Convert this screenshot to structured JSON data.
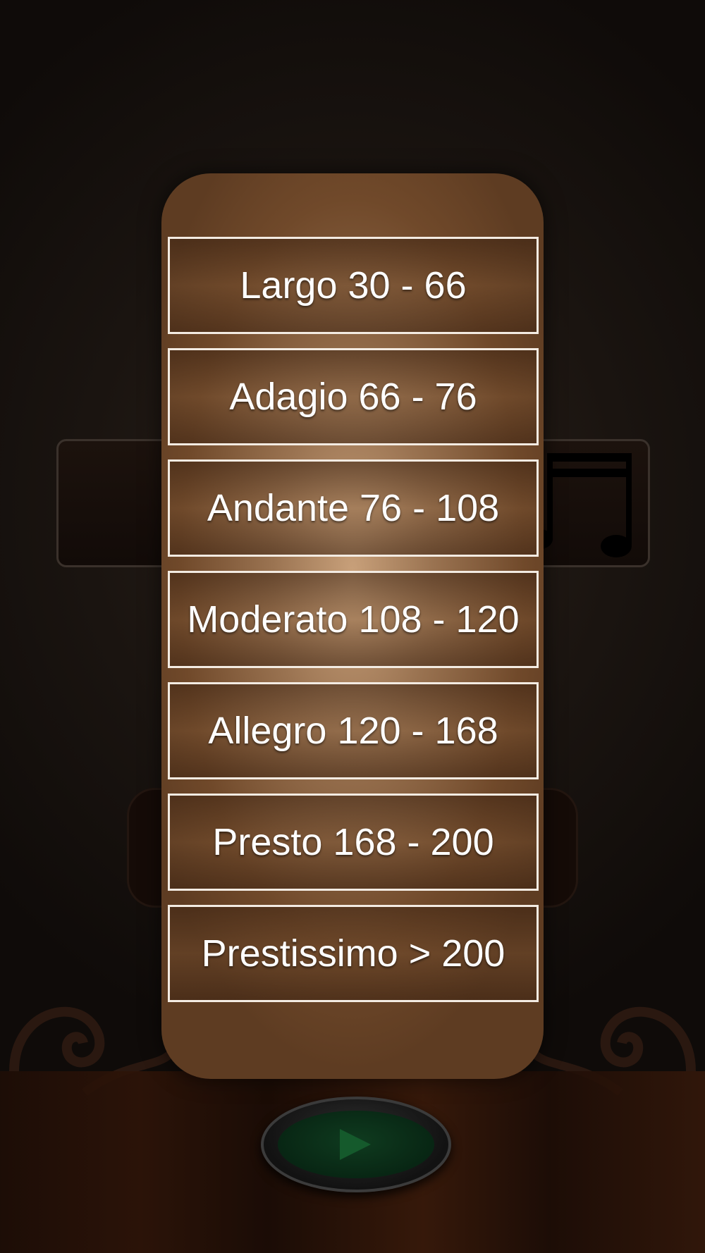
{
  "tempo_picker": {
    "options": [
      {
        "label": "Largo 30 - 66"
      },
      {
        "label": "Adagio 66 - 76"
      },
      {
        "label": "Andante 76 - 108"
      },
      {
        "label": "Moderato 108 - 120"
      },
      {
        "label": "Allegro 120 - 168"
      },
      {
        "label": "Presto 168 - 200"
      },
      {
        "label": "Prestissimo > 200"
      }
    ]
  },
  "icons": {
    "background_notes": "music-notes-icon",
    "play": "play-icon"
  },
  "colors": {
    "picker_light": "#c8a07a",
    "picker_dark": "#5e3c22",
    "option_border": "#f3ebe2",
    "play_green": "#155a2c"
  }
}
